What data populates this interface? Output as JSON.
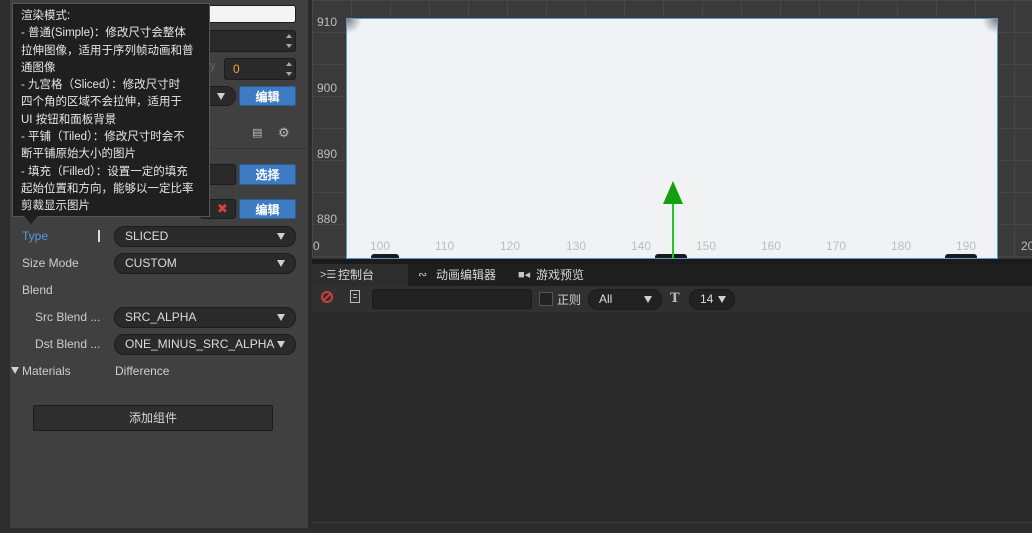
{
  "tooltip": {
    "text": "渲染模式:\n- 普通(Simple)：修改尺寸会整体\n拉伸图像，适用于序列帧动画和普\n通图像\n- 九宫格（Sliced）：修改尺寸时\n四个角的区域不会拉伸，适用于\nUI 按钮和面板背景\n- 平铺（Tiled）：修改尺寸时会不\n断平铺原始大小的图片\n- 填充（Filled）：设置一定的填充\n起始位置和方向，能够以一定比率\n剪裁显示图片"
  },
  "inspector": {
    "number_value": "0",
    "edit_label_1": "编辑",
    "select_label": "选择",
    "edit_label_2": "编辑",
    "properties": {
      "type": {
        "label": "Type",
        "value": "SLICED"
      },
      "size_mode": {
        "label": "Size Mode",
        "value": "CUSTOM"
      },
      "blend": {
        "label": "Blend"
      },
      "src_blend": {
        "label": "Src Blend ...",
        "value": "SRC_ALPHA"
      },
      "dst_blend": {
        "label": "Dst Blend ...",
        "value": "ONE_MINUS_SRC_ALPHA"
      }
    },
    "materials": {
      "label": "Materials",
      "value": "Difference"
    },
    "add_component": "添加组件"
  },
  "scene": {
    "y_ticks": [
      "910",
      "900",
      "890",
      "880"
    ],
    "x_ticks": [
      "0",
      "100",
      "110",
      "120",
      "130",
      "140",
      "150",
      "160",
      "170",
      "180",
      "190",
      "20"
    ]
  },
  "console": {
    "tabs": [
      {
        "label": "控制台",
        "icon": "terminal-icon",
        "active": true
      },
      {
        "label": "动画编辑器",
        "icon": "animation-icon",
        "active": false
      },
      {
        "label": "游戏预览",
        "icon": "video-icon",
        "active": false
      }
    ],
    "regex_label": "正则",
    "filter_value": "All",
    "font_size_value": "14"
  },
  "colors": {
    "accent": "#3d7cc2",
    "number": "#f0a030",
    "gizmo": "#22c822"
  }
}
